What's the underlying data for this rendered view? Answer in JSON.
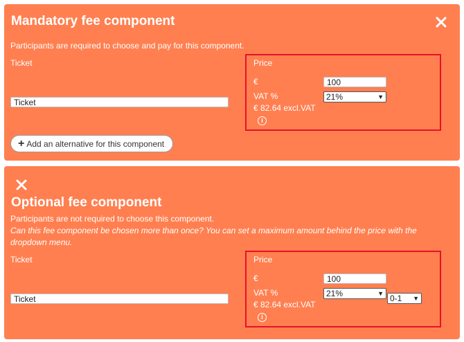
{
  "mandatory": {
    "title": "Mandatory fee component",
    "description": "Participants are required to choose and pay for this component.",
    "ticket_label": "Ticket",
    "ticket_value": "Ticket",
    "price_label": "Price",
    "currency": "€",
    "price_value": "100",
    "vat_label": "VAT %",
    "vat_value": "21%",
    "excl_vat": "€ 82.64 excl.VAT",
    "add_alternative": "Add an alternative for this component"
  },
  "optional": {
    "title": "Optional fee component",
    "description_1": "Participants are not required to choose this component.",
    "description_2": "Can this fee component be chosen more than once? You can set a maximum amount behind the price with the dropdown menu.",
    "ticket_label": "Ticket",
    "ticket_value": "Ticket",
    "price_label": "Price",
    "currency": "€",
    "price_value": "100",
    "vat_label": "VAT %",
    "vat_value": "21%",
    "amount_value": "0-1",
    "excl_vat": "€ 82.64 excl.VAT"
  },
  "colors": {
    "panel": "#ff7f50",
    "highlight": "#e8102a"
  },
  "icons": [
    "close-icon",
    "info-icon",
    "plus-icon",
    "chevron-down-icon"
  ]
}
